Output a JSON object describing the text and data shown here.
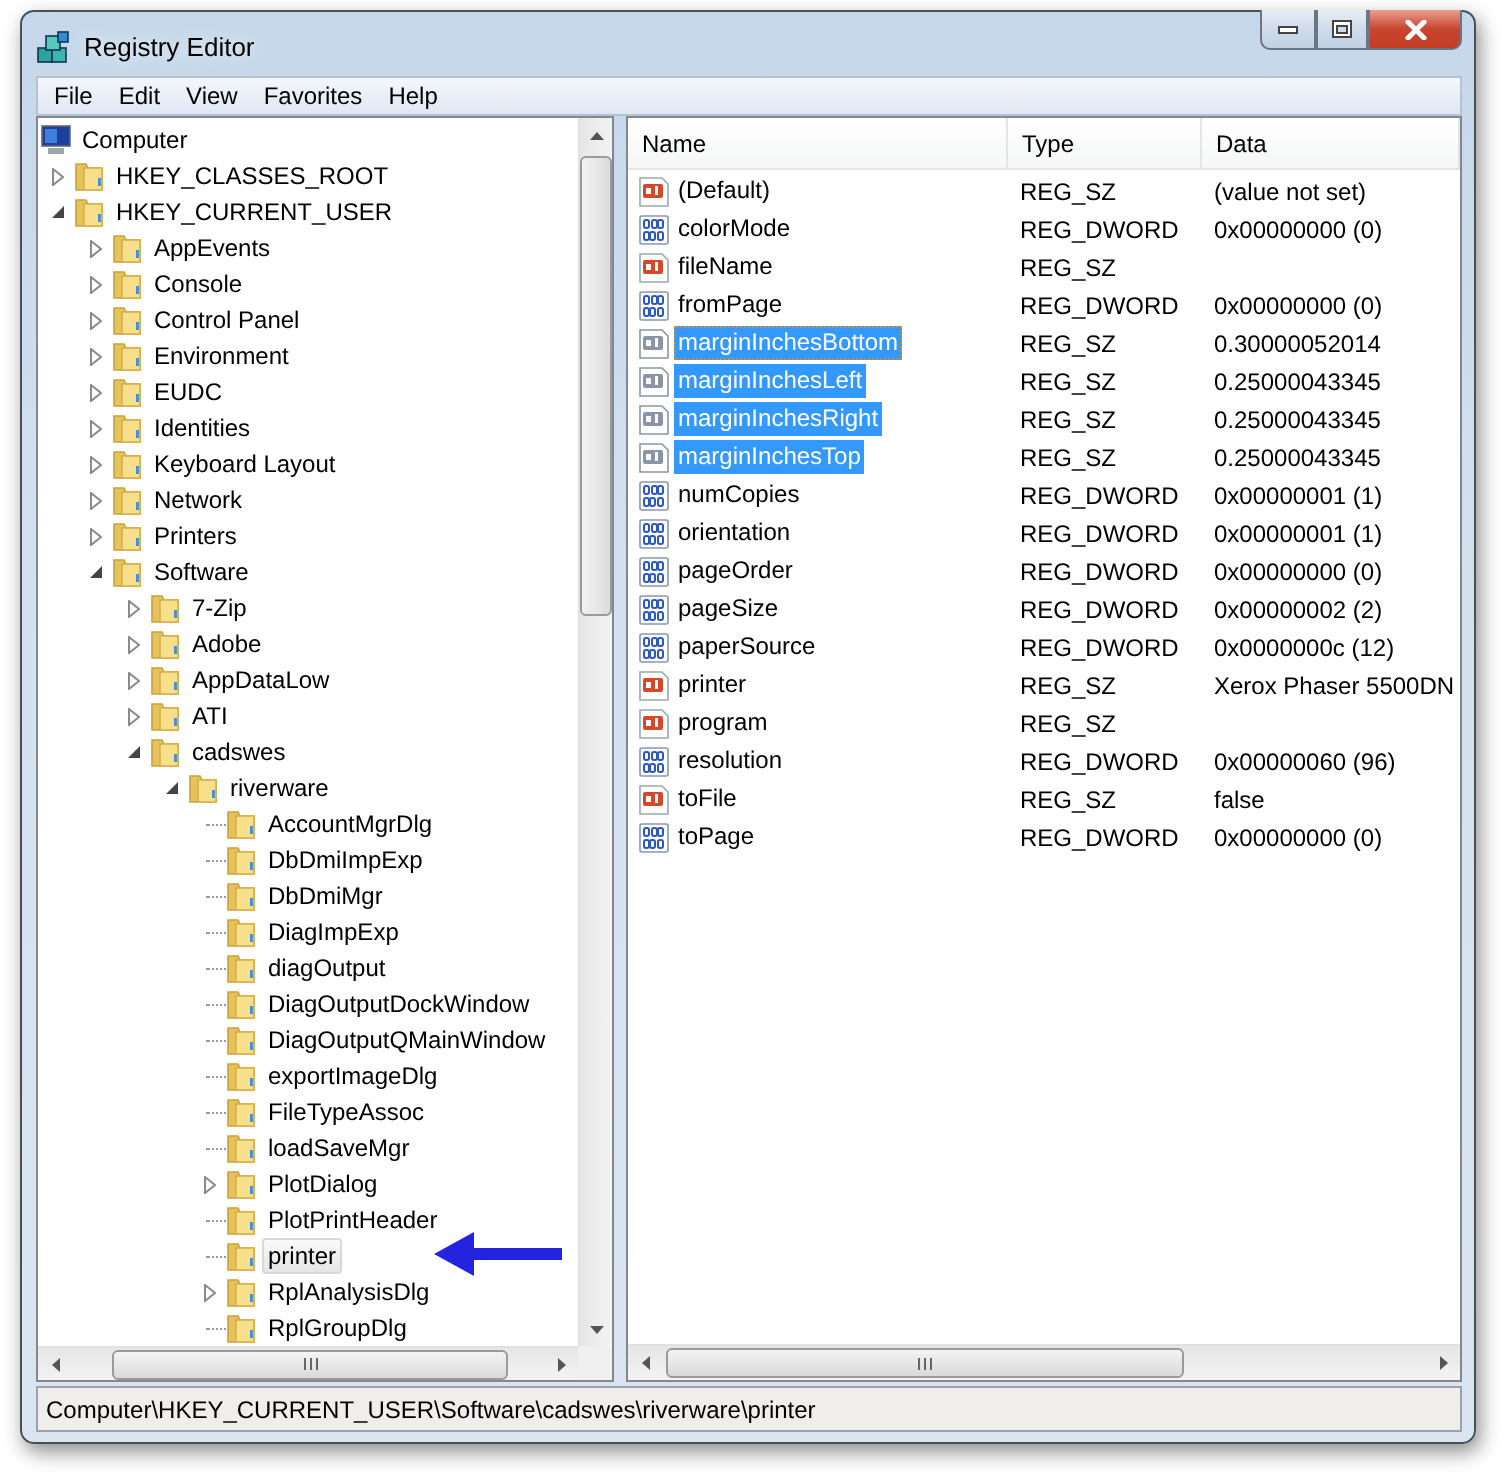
{
  "window": {
    "title": "Registry Editor"
  },
  "menu": [
    "File",
    "Edit",
    "View",
    "Favorites",
    "Help"
  ],
  "tree": {
    "root": {
      "label": "Computer",
      "selected": false,
      "children": [
        {
          "label": "HKEY_CLASSES_ROOT",
          "expandable": true,
          "expanded": false,
          "selected": false
        },
        {
          "label": "HKEY_CURRENT_USER",
          "expandable": true,
          "expanded": true,
          "selected": false,
          "children": [
            {
              "label": "AppEvents",
              "expandable": true,
              "expanded": false,
              "selected": false
            },
            {
              "label": "Console",
              "expandable": true,
              "expanded": false,
              "selected": false
            },
            {
              "label": "Control Panel",
              "expandable": true,
              "expanded": false,
              "selected": false
            },
            {
              "label": "Environment",
              "expandable": true,
              "expanded": false,
              "selected": false
            },
            {
              "label": "EUDC",
              "expandable": true,
              "expanded": false,
              "selected": false
            },
            {
              "label": "Identities",
              "expandable": true,
              "expanded": false,
              "selected": false
            },
            {
              "label": "Keyboard Layout",
              "expandable": true,
              "expanded": false,
              "selected": false
            },
            {
              "label": "Network",
              "expandable": true,
              "expanded": false,
              "selected": false
            },
            {
              "label": "Printers",
              "expandable": true,
              "expanded": false,
              "selected": false
            },
            {
              "label": "Software",
              "expandable": true,
              "expanded": true,
              "selected": false,
              "children": [
                {
                  "label": "7-Zip",
                  "expandable": true,
                  "expanded": false,
                  "selected": false
                },
                {
                  "label": "Adobe",
                  "expandable": true,
                  "expanded": false,
                  "selected": false
                },
                {
                  "label": "AppDataLow",
                  "expandable": true,
                  "expanded": false,
                  "selected": false
                },
                {
                  "label": "ATI",
                  "expandable": true,
                  "expanded": false,
                  "selected": false
                },
                {
                  "label": "cadswes",
                  "expandable": true,
                  "expanded": true,
                  "selected": false,
                  "children": [
                    {
                      "label": "riverware",
                      "expandable": true,
                      "expanded": true,
                      "selected": false,
                      "children": [
                        {
                          "label": "AccountMgrDlg",
                          "expandable": false,
                          "selected": false
                        },
                        {
                          "label": "DbDmiImpExp",
                          "expandable": false,
                          "selected": false
                        },
                        {
                          "label": "DbDmiMgr",
                          "expandable": false,
                          "selected": false
                        },
                        {
                          "label": "DiagImpExp",
                          "expandable": false,
                          "selected": false
                        },
                        {
                          "label": "diagOutput",
                          "expandable": false,
                          "selected": false
                        },
                        {
                          "label": "DiagOutputDockWindow",
                          "expandable": false,
                          "selected": false
                        },
                        {
                          "label": "DiagOutputQMainWindow",
                          "expandable": false,
                          "selected": false
                        },
                        {
                          "label": "exportImageDlg",
                          "expandable": false,
                          "selected": false
                        },
                        {
                          "label": "FileTypeAssoc",
                          "expandable": false,
                          "selected": false
                        },
                        {
                          "label": "loadSaveMgr",
                          "expandable": false,
                          "selected": false
                        },
                        {
                          "label": "PlotDialog",
                          "expandable": true,
                          "expanded": false,
                          "selected": false
                        },
                        {
                          "label": "PlotPrintHeader",
                          "expandable": false,
                          "selected": false
                        },
                        {
                          "label": "printer",
                          "expandable": false,
                          "selected": true
                        },
                        {
                          "label": "RplAnalysisDlg",
                          "expandable": true,
                          "expanded": false,
                          "selected": false
                        },
                        {
                          "label": "RplGroupDlg",
                          "expandable": false,
                          "selected": false
                        }
                      ]
                    }
                  ]
                }
              ]
            }
          ]
        }
      ]
    }
  },
  "values": {
    "columns": [
      "Name",
      "Type",
      "Data"
    ],
    "rows": [
      {
        "kind": "string",
        "name": "(Default)",
        "type": "REG_SZ",
        "data": "(value not set)",
        "selected": false,
        "focused": false
      },
      {
        "kind": "binary",
        "name": "colorMode",
        "type": "REG_DWORD",
        "data": "0x00000000 (0)",
        "selected": false,
        "focused": false
      },
      {
        "kind": "string",
        "name": "fileName",
        "type": "REG_SZ",
        "selected": false,
        "focused": false
      },
      {
        "kind": "binary",
        "name": "fromPage",
        "type": "REG_DWORD",
        "data": "0x00000000 (0)",
        "selected": false,
        "focused": false
      },
      {
        "kind": "string",
        "name": "marginInchesBottom",
        "type": "REG_SZ",
        "data": "0.30000052014",
        "selected": true,
        "focused": true
      },
      {
        "kind": "string",
        "name": "marginInchesLeft",
        "type": "REG_SZ",
        "data": "0.25000043345",
        "selected": true,
        "focused": false
      },
      {
        "kind": "string",
        "name": "marginInchesRight",
        "type": "REG_SZ",
        "data": "0.25000043345",
        "selected": true,
        "focused": false
      },
      {
        "kind": "string",
        "name": "marginInchesTop",
        "type": "REG_SZ",
        "data": "0.25000043345",
        "selected": true,
        "focused": false
      },
      {
        "kind": "binary",
        "name": "numCopies",
        "type": "REG_DWORD",
        "data": "0x00000001 (1)",
        "selected": false,
        "focused": false
      },
      {
        "kind": "binary",
        "name": "orientation",
        "type": "REG_DWORD",
        "data": "0x00000001 (1)",
        "selected": false,
        "focused": false
      },
      {
        "kind": "binary",
        "name": "pageOrder",
        "type": "REG_DWORD",
        "data": "0x00000000 (0)",
        "selected": false,
        "focused": false
      },
      {
        "kind": "binary",
        "name": "pageSize",
        "type": "REG_DWORD",
        "data": "0x00000002 (2)",
        "selected": false,
        "focused": false
      },
      {
        "kind": "binary",
        "name": "paperSource",
        "type": "REG_DWORD",
        "data": "0x0000000c (12)",
        "selected": false,
        "focused": false
      },
      {
        "kind": "string",
        "name": "printer",
        "type": "REG_SZ",
        "data": "Xerox Phaser 5500DN",
        "selected": false,
        "focused": false
      },
      {
        "kind": "string",
        "name": "program",
        "type": "REG_SZ",
        "selected": false,
        "focused": false
      },
      {
        "kind": "binary",
        "name": "resolution",
        "type": "REG_DWORD",
        "data": "0x00000060 (96)",
        "selected": false,
        "focused": false
      },
      {
        "kind": "string",
        "name": "toFile",
        "type": "REG_SZ",
        "data": "false",
        "selected": false,
        "focused": false
      },
      {
        "kind": "binary",
        "name": "toPage",
        "type": "REG_DWORD",
        "data": "0x00000000 (0)",
        "selected": false,
        "focused": false
      }
    ]
  },
  "status_bar": "Computer\\HKEY_CURRENT_USER\\Software\\cadswes\\riverware\\printer"
}
